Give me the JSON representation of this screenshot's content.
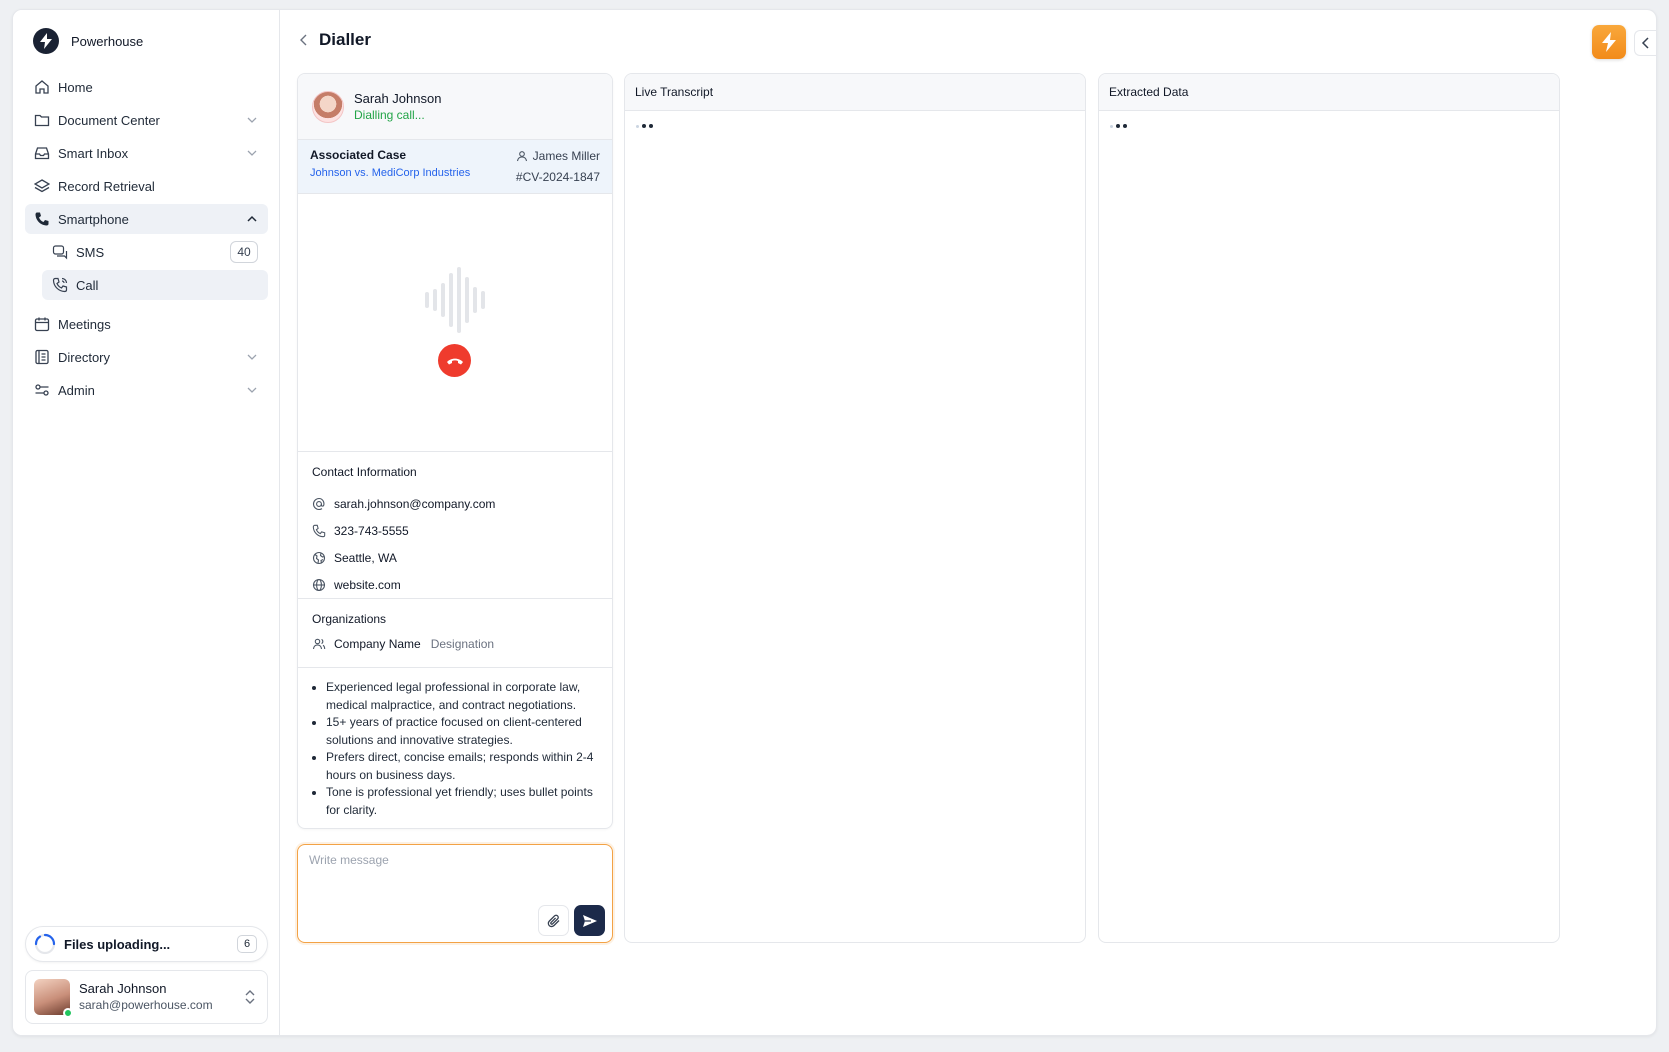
{
  "brand": {
    "name": "Powerhouse"
  },
  "nav": {
    "home": "Home",
    "document_center": "Document Center",
    "smart_inbox": "Smart Inbox",
    "record_retrieval": "Record Retrieval",
    "smartphone": "Smartphone",
    "sms": "SMS",
    "sms_count": "40",
    "call": "Call",
    "meetings": "Meetings",
    "directory": "Directory",
    "admin": "Admin"
  },
  "upload": {
    "label": "Files uploading...",
    "count": "6"
  },
  "user": {
    "name": "Sarah Johnson",
    "email": "sarah@powerhouse.com"
  },
  "page": {
    "title": "Dialler"
  },
  "contact": {
    "name": "Sarah Johnson",
    "status": "Dialling call...",
    "case_label": "Associated Case",
    "case_name": "Johnson vs. MediCorp Industries",
    "case_owner": "James Miller",
    "case_id": "#CV-2024-1847",
    "info_title": "Contact Information",
    "email": "sarah.johnson@company.com",
    "phone": "323-743-5555",
    "location": "Seattle, WA",
    "website": "website.com",
    "orgs_title": "Organizations",
    "org_name": "Company Name",
    "org_designation": "Designation",
    "notes": [
      "Experienced legal professional in corporate law, medical malpractice, and contract negotiations.",
      "15+ years of practice focused on client-centered solutions and innovative strategies.",
      "Prefers direct, concise emails; responds within 2-4 hours on business days.",
      "Tone is professional yet friendly; uses bullet points for clarity."
    ]
  },
  "compose": {
    "placeholder": "Write message",
    "value": ""
  },
  "panels": {
    "transcript_title": "Live Transcript",
    "extracted_title": "Extracted Data"
  },
  "colors": {
    "accent": "#f28b1a",
    "hangup": "#ef3b2d",
    "link": "#2563eb",
    "status_green": "#22a447",
    "send": "#1c2a4a"
  }
}
